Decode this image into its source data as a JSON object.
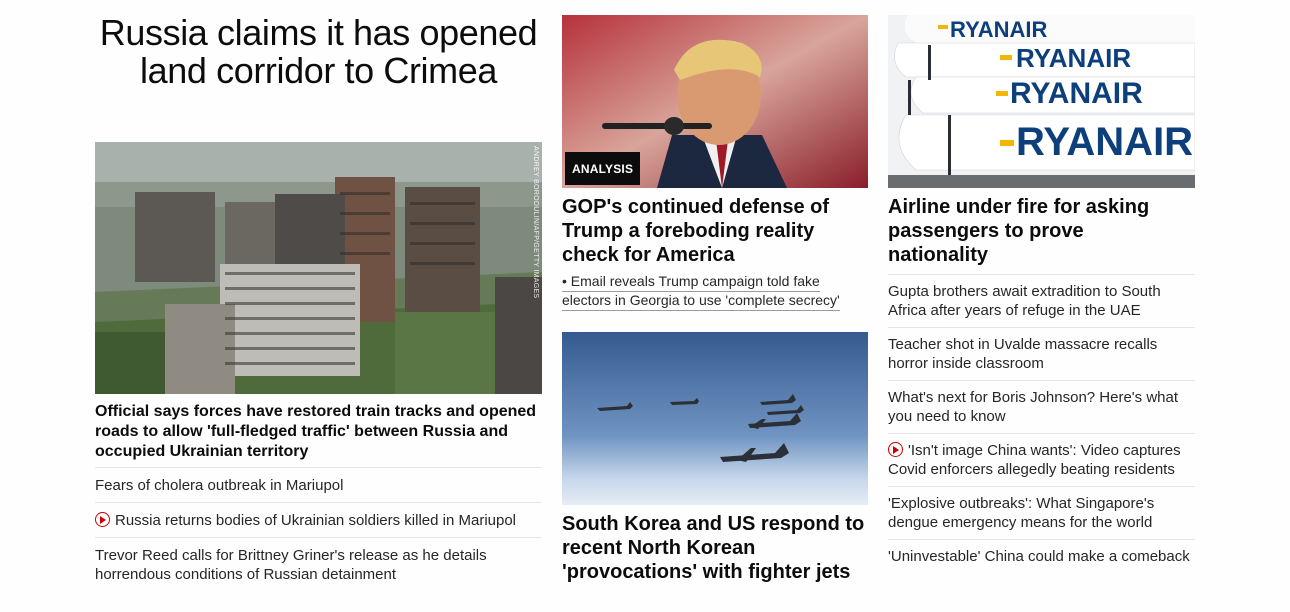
{
  "main_story": {
    "headline": "Russia claims it has opened land corridor to Crimea",
    "photo_credit": "ANDREY BORODULIN/AFP/GETTY IMAGES",
    "lead_text": "Official says forces have restored train tracks and opened roads to allow 'full-fledged traffic' between Russia and occupied Ukrainian territory",
    "related": [
      {
        "text": "Fears of cholera outbreak in Mariupol",
        "video": false
      },
      {
        "text": "Russia returns bodies of Ukrainian soldiers killed in Mariupol",
        "video": true
      },
      {
        "text": "Trevor Reed calls for Brittney Griner's release as he details horrendous conditions of Russian detainment",
        "video": false
      }
    ]
  },
  "card_trump": {
    "badge": "ANALYSIS",
    "headline": "GOP's continued defense of Trump a foreboding reality check for America",
    "related": "• Email reveals Trump campaign told fake electors in Georgia to use 'complete secrecy'"
  },
  "card_korea": {
    "headline": "South Korea and US respond to recent North Korean 'provocations' with fighter jets"
  },
  "card_airline": {
    "plane_text": "RYANAIR",
    "headline": "Airline under fire for asking passengers to prove nationality",
    "list": [
      {
        "text": "Gupta brothers await extradition to South Africa after years of refuge in the UAE",
        "video": false
      },
      {
        "text": "Teacher shot in Uvalde massacre recalls horror inside classroom",
        "video": false
      },
      {
        "text": "What's next for Boris Johnson? Here's what you need to know",
        "video": false
      },
      {
        "text": "'Isn't image China wants': Video captures Covid enforcers allegedly beating residents",
        "video": true
      },
      {
        "text": "'Explosive outbreaks': What Singapore's dengue emergency means for the world",
        "video": false
      },
      {
        "text": "'Uninvestable' China could make a comeback",
        "video": false
      }
    ]
  },
  "colors": {
    "accent": "#cc0000",
    "text": "#0c0c0c",
    "divider": "#e6e6e6"
  }
}
